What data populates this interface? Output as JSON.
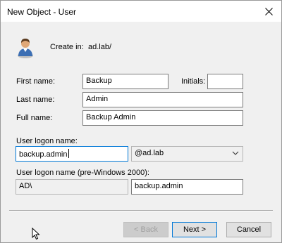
{
  "window": {
    "title": "New Object - User",
    "close_icon": "close-icon"
  },
  "header": {
    "icon": "user-icon",
    "create_in_label": "Create in:",
    "create_in_value": "ad.lab/"
  },
  "form": {
    "first_name_label": "First name:",
    "first_name_value": "Backup",
    "initials_label": "Initials:",
    "initials_value": "",
    "last_name_label": "Last name:",
    "last_name_value": "Admin",
    "full_name_label": "Full name:",
    "full_name_value": "Backup Admin",
    "logon_name_label": "User logon name:",
    "logon_name_value": "backup.admin",
    "domain_suffix_value": "@ad.lab",
    "pre2000_label": "User logon name (pre-Windows 2000):",
    "pre2000_domain_value": "AD\\",
    "pre2000_name_value": "backup.admin"
  },
  "buttons": {
    "back_label": "< Back",
    "next_label": "Next >",
    "cancel_label": "Cancel"
  },
  "colors": {
    "focus_border": "#0078d7",
    "dialog_background": "#f0f0f0"
  }
}
